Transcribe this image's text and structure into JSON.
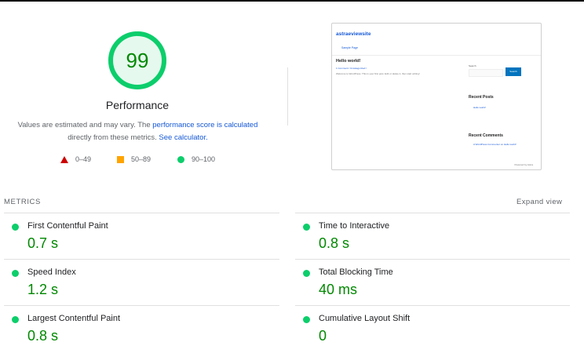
{
  "score": {
    "value": "99",
    "fraction": 0.99,
    "title": "Performance",
    "color": "#0cce6b",
    "text_color": "#008800"
  },
  "description": {
    "part1": "Values are estimated and may vary. The ",
    "link1": "performance score is calculated",
    "part2": "directly from these metrics. ",
    "link2": "See calculator."
  },
  "legend": [
    {
      "icon": "triangle-red-icon",
      "range": "0–49",
      "color": "#cc0000"
    },
    {
      "icon": "square-orange-icon",
      "range": "50–89",
      "color": "#ffa400"
    },
    {
      "icon": "circle-green-icon",
      "range": "90–100",
      "color": "#0cce6b"
    }
  ],
  "screenshot": {
    "site_title": "astraeviewsite",
    "nav_item": "Sample Page",
    "post_title": "Hello world!",
    "post_meta": "1 Comment / Uncategorized / ",
    "post_body": "Welcome to WordPress. This is your first post. Edit or delete it, then start writing!",
    "search_label": "Search",
    "search_button": "Search",
    "recent_posts_heading": "Recent Posts",
    "recent_post_link": "Hello world!",
    "recent_comments_heading": "Recent Comments",
    "recent_comment_link": "A WordPress Commenter on Hello world!",
    "footer": "Powered by Astra"
  },
  "metrics": {
    "title": "METRICS",
    "expand_label": "Expand view",
    "items": [
      {
        "name": "First Contentful Paint",
        "value": "0.7 s"
      },
      {
        "name": "Time to Interactive",
        "value": "0.8 s"
      },
      {
        "name": "Speed Index",
        "value": "1.2 s"
      },
      {
        "name": "Total Blocking Time",
        "value": "40 ms"
      },
      {
        "name": "Largest Contentful Paint",
        "value": "0.8 s"
      },
      {
        "name": "Cumulative Layout Shift",
        "value": "0"
      }
    ]
  }
}
